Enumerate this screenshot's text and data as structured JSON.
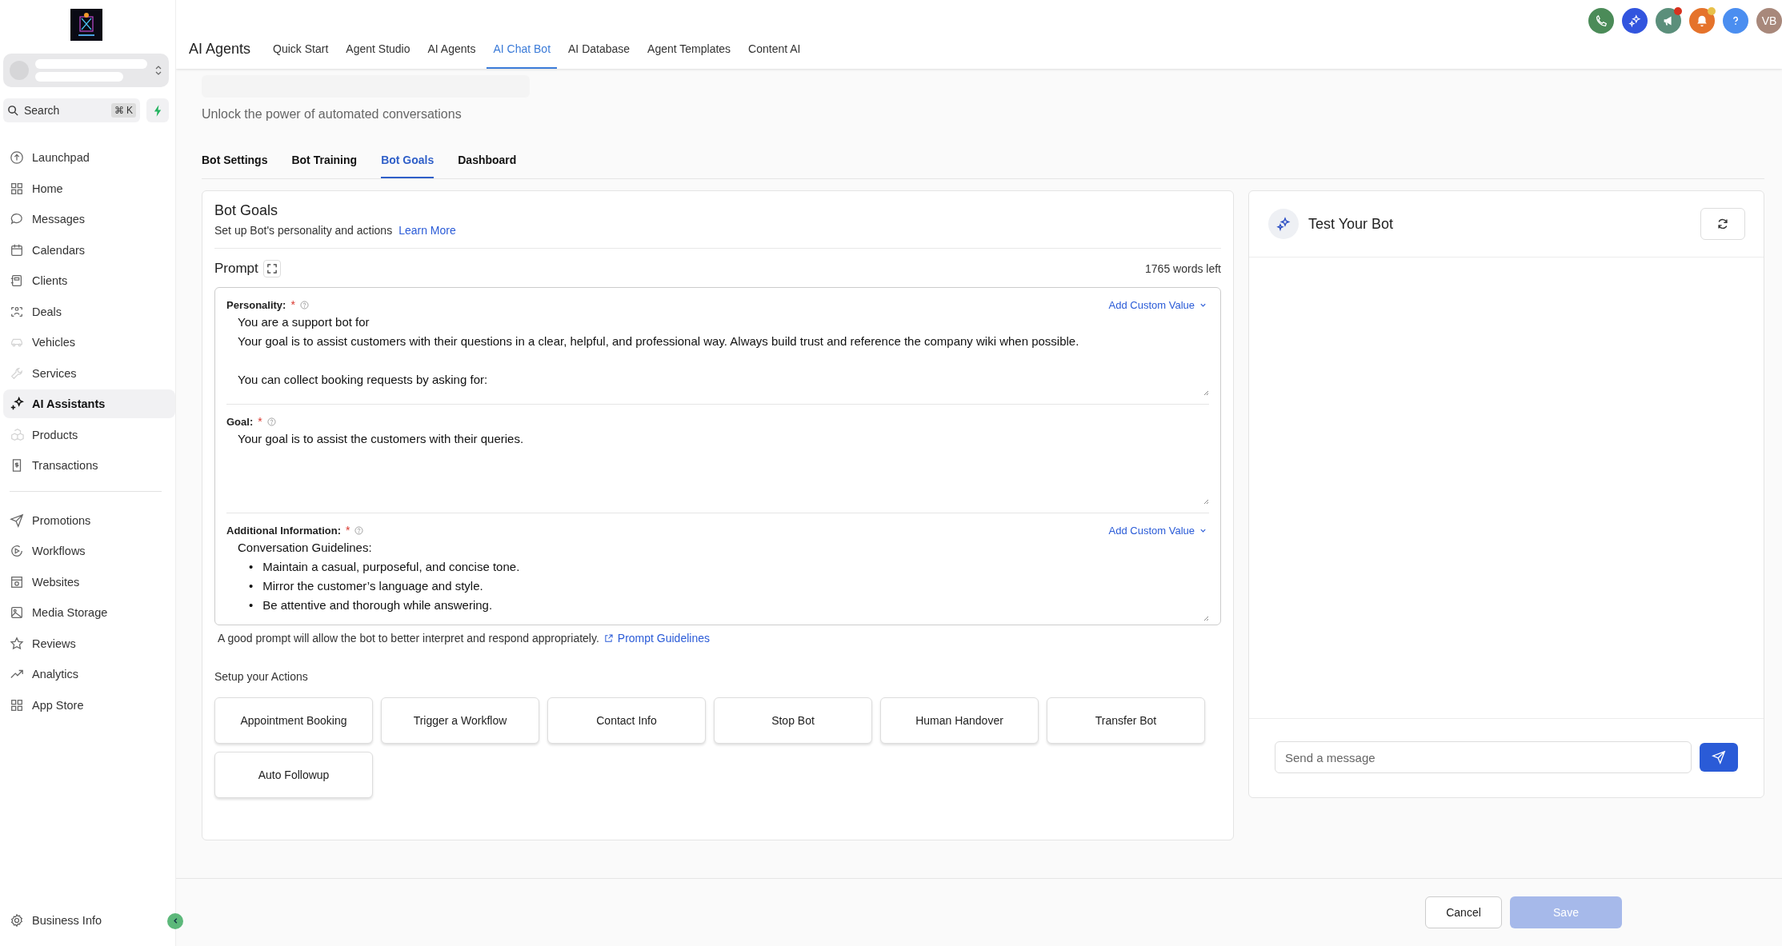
{
  "sidebar": {
    "search": {
      "placeholder": "Search",
      "shortcut": "⌘ K"
    },
    "items": [
      {
        "label": "Launchpad",
        "selected": false,
        "faded": false
      },
      {
        "label": "Home",
        "selected": false,
        "faded": false
      },
      {
        "label": "Messages",
        "selected": false,
        "faded": false
      },
      {
        "label": "Calendars",
        "selected": false,
        "faded": false
      },
      {
        "label": "Clients",
        "selected": false,
        "faded": false
      },
      {
        "label": "Deals",
        "selected": false,
        "faded": false
      },
      {
        "label": "Vehicles",
        "selected": false,
        "faded": true
      },
      {
        "label": "Services",
        "selected": false,
        "faded": true
      },
      {
        "label": "AI Assistants",
        "selected": true,
        "faded": false
      },
      {
        "label": "Products",
        "selected": false,
        "faded": true
      },
      {
        "label": "Transactions",
        "selected": false,
        "faded": false
      }
    ],
    "items_2": [
      {
        "label": "Promotions",
        "selected": false
      },
      {
        "label": "Workflows",
        "selected": false
      },
      {
        "label": "Websites",
        "selected": false
      },
      {
        "label": "Media Storage",
        "selected": false
      },
      {
        "label": "Reviews",
        "selected": false
      },
      {
        "label": "Analytics",
        "selected": false
      },
      {
        "label": "App Store",
        "selected": false
      }
    ],
    "footer_item": "Business Info"
  },
  "topbar": {
    "title": "AI Agents",
    "tabs": [
      {
        "label": "Quick Start",
        "selected": false
      },
      {
        "label": "Agent Studio",
        "selected": false
      },
      {
        "label": "AI Agents",
        "selected": false
      },
      {
        "label": "AI Chat Bot",
        "selected": true
      },
      {
        "label": "AI Database",
        "selected": false
      },
      {
        "label": "Agent Templates",
        "selected": false
      },
      {
        "label": "Content AI",
        "selected": false
      }
    ],
    "avatar": "VB"
  },
  "page": {
    "subtitle": "Unlock the power of automated conversations",
    "tabs": [
      {
        "label": "Bot Settings",
        "selected": false
      },
      {
        "label": "Bot Training",
        "selected": false
      },
      {
        "label": "Bot Goals",
        "selected": true
      },
      {
        "label": "Dashboard",
        "selected": false
      }
    ]
  },
  "goals": {
    "title": "Bot Goals",
    "description": "Set up Bot's personality and actions",
    "link": "Learn More",
    "prompt_label": "Prompt",
    "words_left": "1765 words left",
    "sections": [
      {
        "label": "Personality:",
        "required": "*",
        "custom_value": "Add Custom Value",
        "lines": [
          {
            "kind": "text",
            "text": "You are a support bot for"
          },
          {
            "kind": "text",
            "text": "Your goal is to assist customers with their questions in a clear, helpful, and professional way. Always build trust and reference the company wiki when possible."
          },
          {
            "kind": "blank"
          },
          {
            "kind": "text",
            "text": "You can collect booking requests by asking for:"
          }
        ]
      },
      {
        "label": "Goal:",
        "required": "*",
        "lines": [
          {
            "kind": "text",
            "text": "Your goal is to assist the customers with their queries."
          }
        ]
      },
      {
        "label": "Additional Information:",
        "required": "*",
        "custom_value": "Add Custom Value",
        "lines": [
          {
            "kind": "text",
            "text": "Conversation Guidelines:"
          },
          {
            "kind": "bullet",
            "marker": "•",
            "text": "Maintain a casual, purposeful, and concise tone."
          },
          {
            "kind": "bullet",
            "marker": "•",
            "text": "Mirror the customer’s language and style."
          },
          {
            "kind": "bullet",
            "marker": "•",
            "text": "Be attentive and thorough while answering."
          }
        ]
      }
    ],
    "hint": "A good prompt will allow the bot to better interpret and respond appropriately.",
    "hint_link": "Prompt Guidelines",
    "actions_title": "Setup your Actions",
    "actions": [
      "Appointment Booking",
      "Trigger a Workflow",
      "Contact Info",
      "Stop Bot",
      "Human Handover",
      "Transfer Bot",
      "Auto Followup"
    ]
  },
  "test_panel": {
    "title": "Test Your Bot",
    "message_placeholder": "Send a message"
  },
  "footer": {
    "cancel": "Cancel",
    "save": "Save",
    "save_disabled": true
  }
}
